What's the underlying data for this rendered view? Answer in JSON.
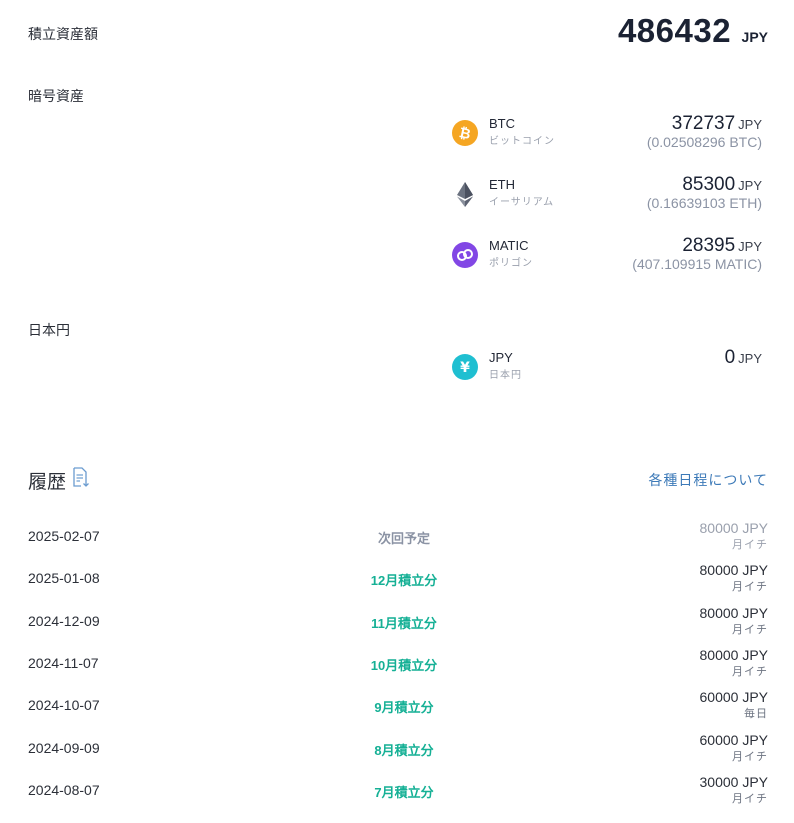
{
  "summary": {
    "label": "積立資産額",
    "total": "486432",
    "unit": "JPY"
  },
  "crypto_section": {
    "label": "暗号資産"
  },
  "assets": [
    {
      "symbol": "BTC",
      "name": "ビットコイン",
      "value": "372737",
      "unit": "JPY",
      "sub": "(0.02508296 BTC)",
      "icon": "bitcoin-icon",
      "color": "#f5a623"
    },
    {
      "symbol": "ETH",
      "name": "イーサリアム",
      "value": "85300",
      "unit": "JPY",
      "sub": "(0.16639103 ETH)",
      "icon": "ethereum-icon",
      "color": "#6b7280"
    },
    {
      "symbol": "MATIC",
      "name": "ポリゴン",
      "value": "28395",
      "unit": "JPY",
      "sub": "(407.109915 MATIC)",
      "icon": "polygon-icon",
      "color": "#8247e5"
    }
  ],
  "yen_section": {
    "label": "日本円"
  },
  "yen": {
    "symbol": "JPY",
    "name": "日本円",
    "value": "0",
    "unit": "JPY",
    "icon": "yen-icon",
    "color": "#1fbfd1"
  },
  "history": {
    "title": "履歴",
    "download_icon": "document-download-icon",
    "schedule_link": "各種日程について",
    "rows": [
      {
        "date": "2025-02-07",
        "label": "次回予定",
        "amount": "80000 JPY",
        "frequency": "月イチ",
        "status": "pending"
      },
      {
        "date": "2025-01-08",
        "label": "12月積立分",
        "amount": "80000 JPY",
        "frequency": "月イチ",
        "status": "done"
      },
      {
        "date": "2024-12-09",
        "label": "11月積立分",
        "amount": "80000 JPY",
        "frequency": "月イチ",
        "status": "done"
      },
      {
        "date": "2024-11-07",
        "label": "10月積立分",
        "amount": "80000 JPY",
        "frequency": "月イチ",
        "status": "done"
      },
      {
        "date": "2024-10-07",
        "label": "9月積立分",
        "amount": "60000 JPY",
        "frequency": "毎日",
        "status": "done"
      },
      {
        "date": "2024-09-09",
        "label": "8月積立分",
        "amount": "60000 JPY",
        "frequency": "月イチ",
        "status": "done"
      },
      {
        "date": "2024-08-07",
        "label": "7月積立分",
        "amount": "30000 JPY",
        "frequency": "月イチ",
        "status": "done"
      }
    ]
  }
}
